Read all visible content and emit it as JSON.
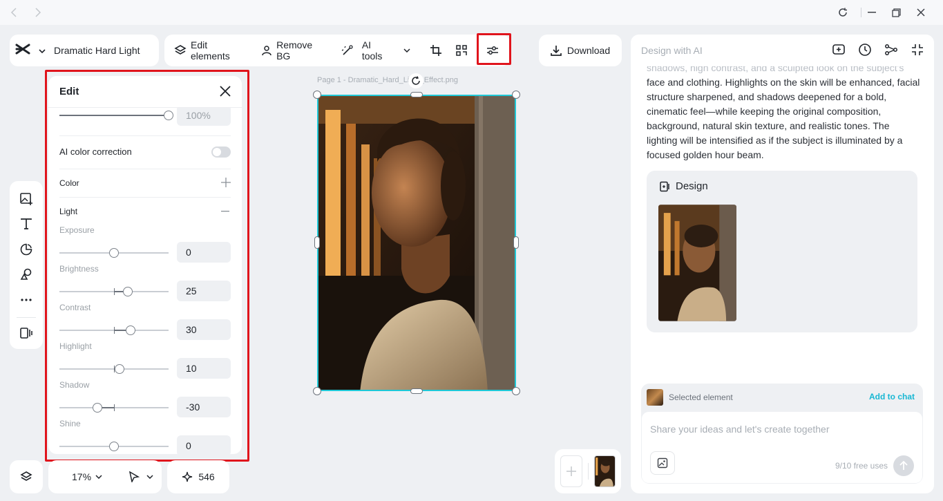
{
  "app": {
    "project_name": "Dramatic Hard Light"
  },
  "toolbar": {
    "edit_elements": "Edit elements",
    "remove_bg": "Remove BG",
    "ai_tools": "AI tools",
    "download": "Download"
  },
  "canvas": {
    "page_label": "Page 1 -   Dramatic_Hard_Light_Effect.png"
  },
  "edit_panel": {
    "title": "Edit",
    "opacity_value": "100%",
    "ai_color_correction": "AI color correction",
    "color_label": "Color",
    "light_label": "Light",
    "sliders": [
      {
        "label": "Exposure",
        "value": "0",
        "level": 0.5
      },
      {
        "label": "Brightness",
        "value": "25",
        "level": 0.625
      },
      {
        "label": "Contrast",
        "value": "30",
        "level": 0.65
      },
      {
        "label": "Highlight",
        "value": "10",
        "level": 0.55
      },
      {
        "label": "Shadow",
        "value": "-30",
        "level": 0.35
      },
      {
        "label": "Shine",
        "value": "0",
        "level": 0.5
      }
    ]
  },
  "ai_panel": {
    "title": "Design with AI",
    "faded_line": "shadows, high contrast, and a sculpted look on the subject's",
    "message": "face and clothing. Highlights on the skin will be enhanced, facial structure sharpened, and shadows deepened for a bold, cinematic feel—while keeping the original composition, background, natural skin texture, and realistic tones. The lighting will be intensified as if the subject is illuminated by a focused golden hour beam.",
    "design_card_title": "Design",
    "selected_element": "Selected element",
    "add_to_chat": "Add to chat",
    "input_placeholder": "Share your ideas and let's create together",
    "free_uses": "9/10 free uses"
  },
  "bottom": {
    "zoom": "17%",
    "credits": "546"
  },
  "colors": {
    "accent": "#1fc8d7",
    "highlight_box": "#e0141c",
    "link": "#18b7d3"
  }
}
